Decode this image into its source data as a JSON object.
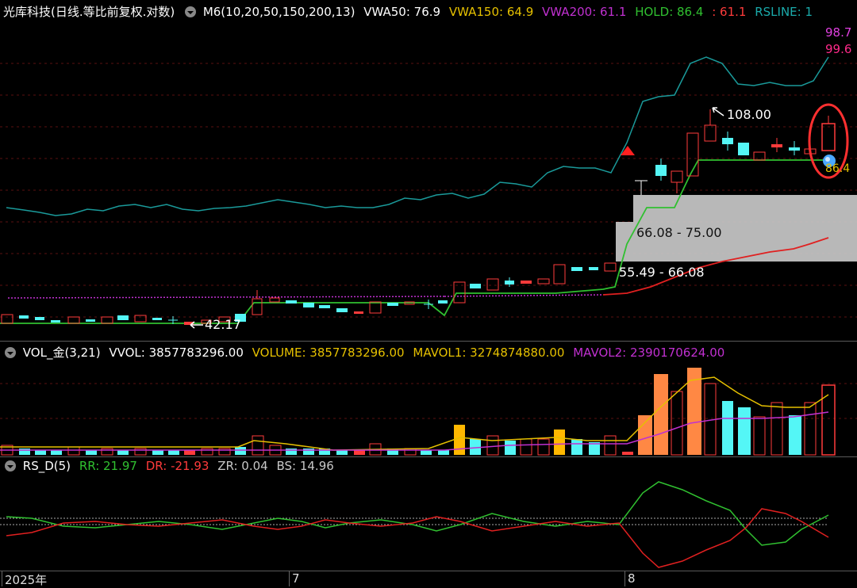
{
  "main_legend": {
    "title": "光库科技(日线.等比前复权.对数)",
    "indicator": "M6(10,20,50,150,200,13)",
    "vwa50": "VWA50: 76.9",
    "vwa150": "VWA150: 64.9",
    "vwa200": "VWA200: 61.1",
    "hold": "HOLD: 86.4",
    "hold_extra": ": 61.1",
    "rsline": "RSLINE: 1"
  },
  "main_labels": {
    "price_right_1": "98.7",
    "price_right_2": "99.6",
    "high": "108.00",
    "low": "42.17",
    "zone_upper": "66.08 - 75.00",
    "zone_lower": "55.49 - 66.08",
    "hold_value": "86.4"
  },
  "vol_legend": {
    "name": "VOL_金(3,21)",
    "vvol": "VVOL: 3857783296.00",
    "volume": "VOLUME: 3857783296.00",
    "mavol1": "MAVOL1: 3274874880.00",
    "mavol2": "MAVOL2: 2390170624.00"
  },
  "rs_legend": {
    "name": "RS_D(5)",
    "rr": "RR: 21.97",
    "dr": "DR: -21.93",
    "zr": "ZR: 0.04",
    "bs": "BS: 14.96"
  },
  "x_axis": {
    "year_label": "2025年",
    "month_7": "7",
    "month_8": "8"
  },
  "colors": {
    "up": "#ff3b3b",
    "down": "#54f6f6",
    "vwa50": "#ffffff",
    "vwa150": "#e5c000",
    "vwa200": "#c030d0",
    "hold": "#30c030",
    "rsline": "#1a9a9a",
    "vol_gold": "#ffb800",
    "vol_orange": "#ff8844"
  }
}
